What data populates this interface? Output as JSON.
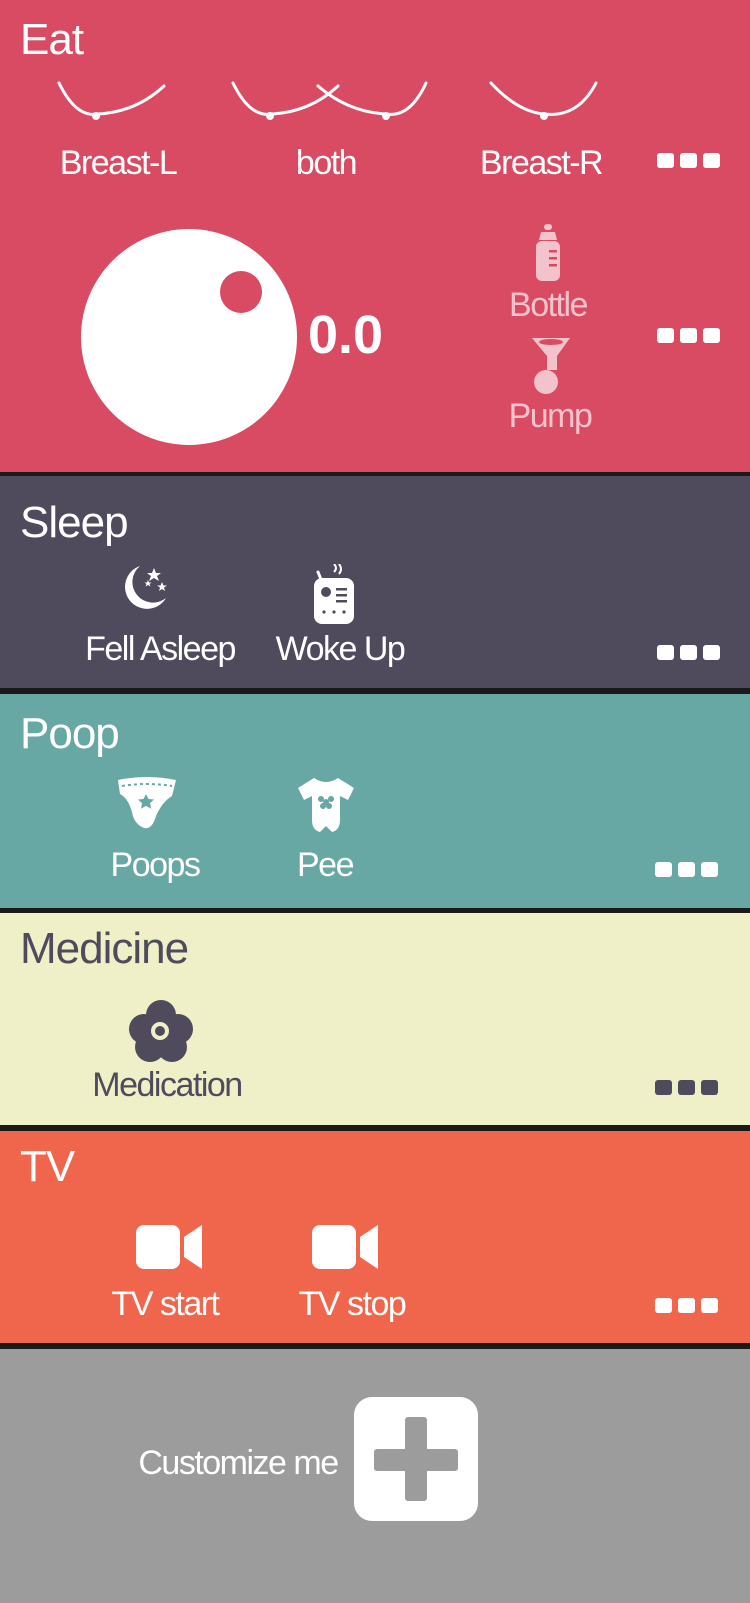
{
  "colors": {
    "eat": "#d84b63",
    "sleep": "#4f4b5c",
    "poop": "#67a8a4",
    "medicine": "#eff0c8",
    "tv": "#f0664c",
    "customize": "#9c9c9c",
    "separator": "#1a1a1a"
  },
  "eat": {
    "title": "Eat",
    "breast_left": "Breast-L",
    "both": "both",
    "breast_right": "Breast-R",
    "timer_value": "0.0",
    "bottle": "Bottle",
    "pump": "Pump",
    "icons": [
      "breast-left-icon",
      "breast-both-icon",
      "breast-right-icon",
      "timer-dial-icon",
      "bottle-icon",
      "pump-icon",
      "more-icon"
    ]
  },
  "sleep": {
    "title": "Sleep",
    "fell_asleep": "Fell Asleep",
    "woke_up": "Woke Up",
    "icons": [
      "moon-stars-icon",
      "baby-monitor-icon",
      "more-icon"
    ]
  },
  "poop": {
    "title": "Poop",
    "poops": "Poops",
    "pee": "Pee",
    "icons": [
      "diaper-icon",
      "onesie-icon",
      "more-icon"
    ]
  },
  "medicine": {
    "title": "Medicine",
    "medication": "Medication",
    "icons": [
      "flower-pill-icon",
      "more-icon"
    ]
  },
  "tv": {
    "title": "TV",
    "tv_start": "TV start",
    "tv_stop": "TV stop",
    "icons": [
      "video-camera-icon",
      "more-icon"
    ]
  },
  "customize": {
    "label": "Customize me",
    "icons": [
      "plus-icon"
    ]
  }
}
